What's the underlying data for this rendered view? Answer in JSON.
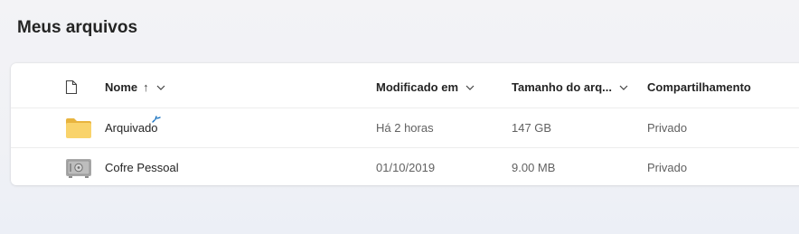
{
  "page": {
    "title": "Meus arquivos"
  },
  "columns": {
    "name": "Nome",
    "name_sort_glyph": "↑",
    "modified": "Modificado em",
    "size": "Tamanho do arq...",
    "sharing": "Compartilhamento"
  },
  "rows": [
    {
      "icon": "folder-icon",
      "name": "Arquivado",
      "modified": "Há 2 horas",
      "size": "147 GB",
      "sharing": "Privado"
    },
    {
      "icon": "vault-icon",
      "name": "Cofre Pessoal",
      "modified": "01/10/2019",
      "size": "9.00 MB",
      "sharing": "Privado"
    }
  ],
  "colors": {
    "folder": "#f9d36b",
    "folder_tab": "#e8b43e",
    "accent": "#0f6cbd"
  }
}
